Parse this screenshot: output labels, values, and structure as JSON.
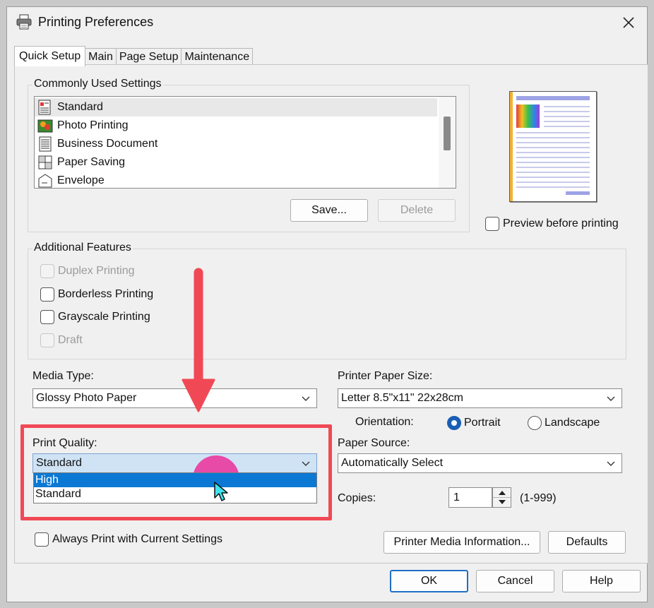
{
  "window": {
    "title": "Printing Preferences",
    "close_icon": "close-icon"
  },
  "tabs": [
    {
      "label": "Quick Setup",
      "active": true
    },
    {
      "label": "Main",
      "active": false
    },
    {
      "label": "Page Setup",
      "active": false
    },
    {
      "label": "Maintenance",
      "active": false
    }
  ],
  "common_settings": {
    "group_label": "Commonly Used Settings",
    "items": [
      {
        "label": "Standard",
        "icon": "standard-icon",
        "selected": true
      },
      {
        "label": "Photo Printing",
        "icon": "photo-icon",
        "selected": false
      },
      {
        "label": "Business Document",
        "icon": "document-icon",
        "selected": false
      },
      {
        "label": "Paper Saving",
        "icon": "paper-saving-icon",
        "selected": false
      },
      {
        "label": "Envelope",
        "icon": "envelope-icon",
        "selected": false
      }
    ],
    "save_label": "Save...",
    "delete_label": "Delete"
  },
  "preview": {
    "checkbox_label": "Preview before printing",
    "checked": false
  },
  "additional_features": {
    "group_label": "Additional Features",
    "duplex_label": "Duplex Printing",
    "borderless_label": "Borderless Printing",
    "grayscale_label": "Grayscale Printing",
    "draft_label": "Draft"
  },
  "media_type": {
    "label": "Media Type:",
    "value": "Glossy Photo Paper"
  },
  "print_quality": {
    "label": "Print Quality:",
    "value": "Standard",
    "options": [
      "High",
      "Standard"
    ],
    "highlighted": "High"
  },
  "paper_size": {
    "label": "Printer Paper Size:",
    "value": "Letter 8.5\"x11\" 22x28cm"
  },
  "orientation": {
    "label": "Orientation:",
    "portrait_label": "Portrait",
    "landscape_label": "Landscape",
    "selected": "Portrait"
  },
  "paper_source": {
    "label": "Paper Source:",
    "value": "Automatically Select"
  },
  "copies": {
    "label": "Copies:",
    "value": "1",
    "range": "(1-999)"
  },
  "always_print_label": "Always Print with Current Settings",
  "media_info_label": "Printer Media Information...",
  "defaults_label": "Defaults",
  "footer": {
    "ok_label": "OK",
    "cancel_label": "Cancel",
    "help_label": "Help"
  },
  "colors": {
    "annotation_red": "#f04955",
    "highlight_blue": "#0b78d4",
    "pink_marker": "#e84aa8",
    "radio_blue": "#1a5fb4"
  }
}
